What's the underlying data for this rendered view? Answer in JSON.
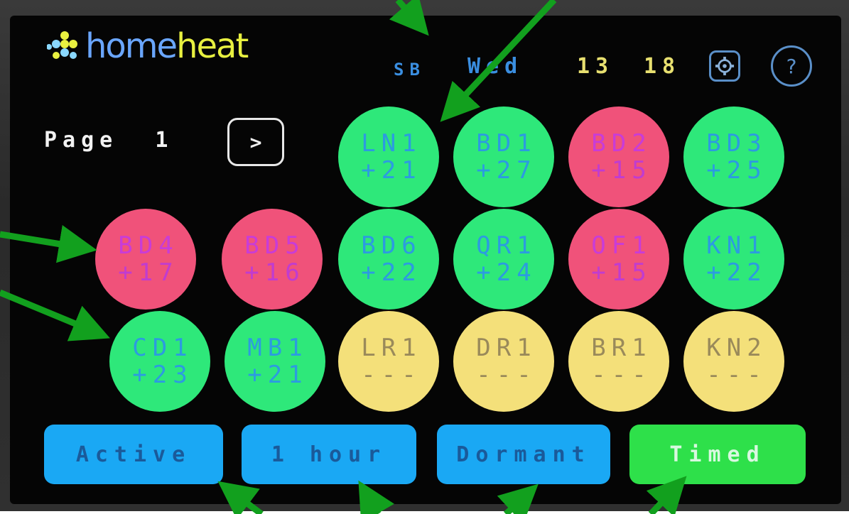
{
  "header": {
    "logo_text_home": "homeheat",
    "user": "SB",
    "day": "Wed",
    "hour": "13",
    "minute": "18",
    "settings_icon": "gear-icon",
    "help_label": "?"
  },
  "page": {
    "label": "Page  1",
    "next_label": ">"
  },
  "zones": [
    {
      "name": "LN1",
      "temp": "+21",
      "state": "ok"
    },
    {
      "name": "BD1",
      "temp": "+27",
      "state": "ok"
    },
    {
      "name": "BD2",
      "temp": "+15",
      "state": "hot"
    },
    {
      "name": "BD3",
      "temp": "+25",
      "state": "ok"
    },
    {
      "name": "BD4",
      "temp": "+17",
      "state": "hot"
    },
    {
      "name": "BD5",
      "temp": "+16",
      "state": "hot"
    },
    {
      "name": "BD6",
      "temp": "+22",
      "state": "ok"
    },
    {
      "name": "QR1",
      "temp": "+24",
      "state": "ok"
    },
    {
      "name": "OF1",
      "temp": "+15",
      "state": "hot"
    },
    {
      "name": "KN1",
      "temp": "+22",
      "state": "ok"
    },
    {
      "name": "CD1",
      "temp": "+23",
      "state": "ok"
    },
    {
      "name": "MB1",
      "temp": "+21",
      "state": "ok"
    },
    {
      "name": "LR1",
      "temp": "---",
      "state": "off"
    },
    {
      "name": "DR1",
      "temp": "---",
      "state": "off"
    },
    {
      "name": "BR1",
      "temp": "---",
      "state": "off"
    },
    {
      "name": "KN2",
      "temp": "---",
      "state": "off"
    }
  ],
  "modes": {
    "active": "Active",
    "hour": "1 hour",
    "dormant": "Dormant",
    "timed": "Timed"
  },
  "colors": {
    "zone_ok": "#2ee87a",
    "zone_hot": "#f0527a",
    "zone_off": "#f4e07a",
    "button_blue": "#1aa8f4",
    "button_green": "#2ee04a",
    "arrow": "#12a01e"
  }
}
